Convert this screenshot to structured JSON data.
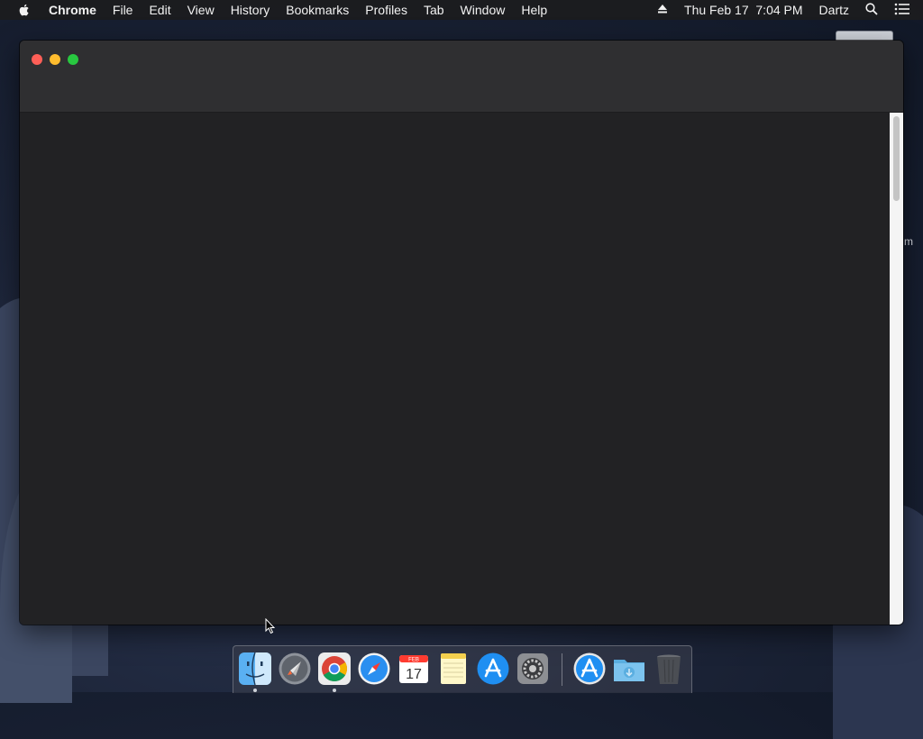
{
  "menubar": {
    "app_name": "Chrome",
    "items": [
      "File",
      "Edit",
      "View",
      "History",
      "Bookmarks",
      "Profiles",
      "Tab",
      "Window",
      "Help"
    ],
    "datetime": "Thu Feb 17  7:04 PM",
    "user": "Dartz"
  },
  "desktop": {
    "partial_label": "m"
  },
  "window": {
    "traffic_colors": {
      "close": "#fe5f57",
      "minimize": "#febc2e",
      "maximize": "#28c840"
    },
    "content_color": "#222224"
  },
  "dock": {
    "apps": [
      {
        "name": "Finder",
        "icon": "finder-icon",
        "running": true
      },
      {
        "name": "Launchpad",
        "icon": "launchpad-icon",
        "running": false
      },
      {
        "name": "Google Chrome",
        "icon": "chrome-icon",
        "running": true
      },
      {
        "name": "Safari",
        "icon": "safari-icon",
        "running": false
      },
      {
        "name": "Calendar",
        "icon": "calendar-icon",
        "running": false,
        "month": "FEB",
        "day": "17"
      },
      {
        "name": "Notes",
        "icon": "notes-icon",
        "running": false
      },
      {
        "name": "App Store",
        "icon": "app-store-icon",
        "running": false
      },
      {
        "name": "System Preferences",
        "icon": "system-preferences-icon",
        "running": false
      },
      {
        "name": "Applications",
        "icon": "applications-folder-icon",
        "running": false
      },
      {
        "name": "Downloads",
        "icon": "downloads-folder-icon",
        "running": false
      },
      {
        "name": "Trash",
        "icon": "trash-icon",
        "running": false
      }
    ]
  }
}
